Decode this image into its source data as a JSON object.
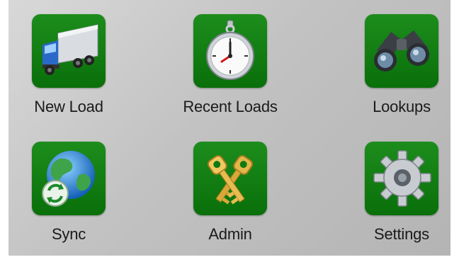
{
  "menu": {
    "items": [
      {
        "label": "New Load",
        "icon": "truck-icon"
      },
      {
        "label": "Recent Loads",
        "icon": "stopwatch-icon"
      },
      {
        "label": "Lookups",
        "icon": "binoculars-icon"
      },
      {
        "label": "Sync",
        "icon": "globe-sync-icon"
      },
      {
        "label": "Admin",
        "icon": "keys-icon"
      },
      {
        "label": "Settings",
        "icon": "gear-icon"
      }
    ]
  },
  "colors": {
    "tile_green": "#0f7a0f",
    "background_gray": "#c4c4c4"
  }
}
